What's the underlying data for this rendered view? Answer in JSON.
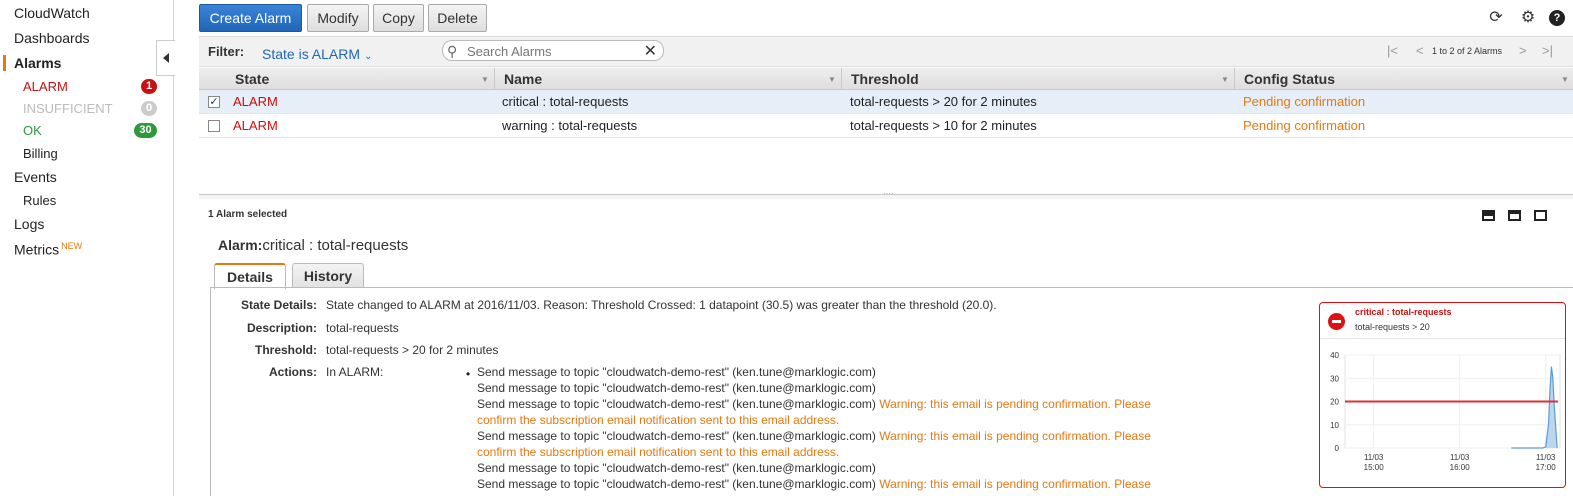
{
  "sidebar": {
    "items": [
      {
        "label": "CloudWatch"
      },
      {
        "label": "Dashboards"
      },
      {
        "label": "Alarms"
      },
      {
        "label": "ALARM",
        "count": "1"
      },
      {
        "label": "INSUFFICIENT",
        "count": "0"
      },
      {
        "label": "OK",
        "count": "30"
      },
      {
        "label": "Billing"
      },
      {
        "label": "Events"
      },
      {
        "label": "Rules"
      },
      {
        "label": "Logs"
      },
      {
        "label": "Metrics",
        "tag": "NEW"
      }
    ]
  },
  "toolbar": {
    "create_label": "Create Alarm",
    "modify_label": "Modify",
    "copy_label": "Copy",
    "delete_label": "Delete",
    "icons": [
      "refresh-icon",
      "gear-icon",
      "help-icon"
    ]
  },
  "filter": {
    "label": "Filter:",
    "value": "State is ALARM",
    "search_placeholder": "Search Alarms",
    "pager_text": "1 to 2 of 2 Alarms"
  },
  "table": {
    "columns": [
      "State",
      "Name",
      "Threshold",
      "Config Status"
    ],
    "rows": [
      {
        "checked": true,
        "state": "ALARM",
        "name": "critical : total-requests",
        "threshold": "total-requests > 20 for 2 minutes",
        "config": "Pending confirmation"
      },
      {
        "checked": false,
        "state": "ALARM",
        "name": "warning : total-requests",
        "threshold": "total-requests > 10 for 2 minutes",
        "config": "Pending confirmation"
      }
    ]
  },
  "detail": {
    "selected_count": "1 Alarm selected",
    "alarm_label": "Alarm:",
    "alarm_name": "critical : total-requests",
    "tabs": [
      "Details",
      "History"
    ],
    "state_details_label": "State Details:",
    "state_details": "State changed to ALARM at 2016/11/03. Reason: Threshold Crossed: 1 datapoint (30.5) was greater than the threshold (20.0).",
    "description_label": "Description:",
    "description": "total-requests",
    "threshold_label": "Threshold:",
    "threshold": "total-requests > 20 for 2 minutes",
    "actions_label": "Actions:",
    "actions_state": "In ALARM:",
    "action_lines": [
      {
        "text": "Send message to topic \"cloudwatch-demo-rest\" (ken.tune@marklogic.com)",
        "warn": ""
      },
      {
        "text": "Send message to topic \"cloudwatch-demo-rest\" (ken.tune@marklogic.com)",
        "warn": ""
      },
      {
        "text": "Send message to topic \"cloudwatch-demo-rest\" (ken.tune@marklogic.com)",
        "warn": " Warning: this email is pending confirmation. Please"
      },
      {
        "text": "",
        "warn": "confirm the subscription email notification sent to this email address."
      },
      {
        "text": "Send message to topic \"cloudwatch-demo-rest\" (ken.tune@marklogic.com)",
        "warn": " Warning: this email is pending confirmation. Please"
      },
      {
        "text": "",
        "warn": "confirm the subscription email notification sent to this email address."
      },
      {
        "text": "Send message to topic \"cloudwatch-demo-rest\" (ken.tune@marklogic.com)",
        "warn": ""
      },
      {
        "text": "Send message to topic \"cloudwatch-demo-rest\" (ken.tune@marklogic.com)",
        "warn": " Warning: this email is pending confirmation. Please"
      }
    ]
  },
  "mini_chart": {
    "title": "critical : total-requests",
    "subtitle": "total-requests > 20",
    "colors": {
      "threshold": "#e03030",
      "series": "#5b9bd5",
      "fill": "#bcd6ee",
      "border": "#dd1111"
    }
  },
  "chart_data": {
    "type": "area",
    "title": "critical : total-requests",
    "subtitle": "total-requests > 20",
    "ylim": [
      0,
      40
    ],
    "yticks": [
      0,
      10,
      20,
      30,
      40
    ],
    "xticks": [
      "11/03\n15:00",
      "11/03\n16:00",
      "11/03\n17:00"
    ],
    "xlim_minutes": [
      -20,
      130
    ],
    "threshold": 20,
    "series": [
      {
        "x": [
          96,
          108,
          118,
          120,
          122,
          123,
          124,
          125,
          126,
          128
        ],
        "y": [
          0,
          0,
          0,
          0.5,
          10,
          25,
          35,
          30,
          18,
          0
        ]
      }
    ]
  }
}
